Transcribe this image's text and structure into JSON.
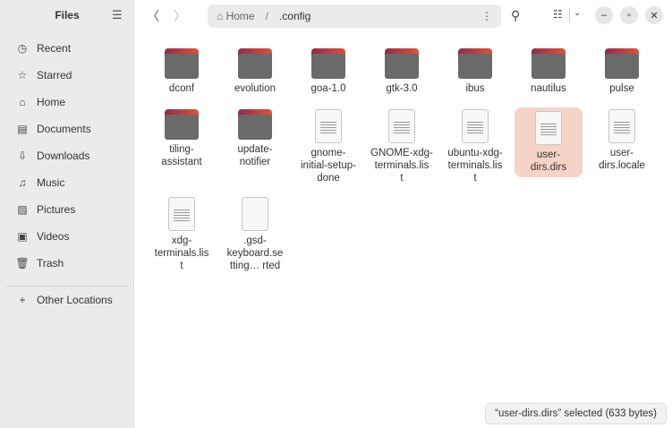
{
  "sidebar": {
    "title": "Files",
    "items": [
      {
        "label": "Recent",
        "icon": "clock"
      },
      {
        "label": "Starred",
        "icon": "star"
      },
      {
        "label": "Home",
        "icon": "home"
      },
      {
        "label": "Documents",
        "icon": "document"
      },
      {
        "label": "Downloads",
        "icon": "download"
      },
      {
        "label": "Music",
        "icon": "music"
      },
      {
        "label": "Pictures",
        "icon": "picture"
      },
      {
        "label": "Videos",
        "icon": "video"
      },
      {
        "label": "Trash",
        "icon": "trash"
      }
    ],
    "other": "Other Locations"
  },
  "path": {
    "home": "Home",
    "sep": "/",
    "current": ".config"
  },
  "files": [
    {
      "name": "dconf",
      "type": "folder"
    },
    {
      "name": "evolution",
      "type": "folder"
    },
    {
      "name": "goa-1.0",
      "type": "folder"
    },
    {
      "name": "gtk-3.0",
      "type": "folder"
    },
    {
      "name": "ibus",
      "type": "folder"
    },
    {
      "name": "nautilus",
      "type": "folder"
    },
    {
      "name": "pulse",
      "type": "folder"
    },
    {
      "name": "tiling-\nassistant",
      "type": "folder"
    },
    {
      "name": "update-\nnotifier",
      "type": "folder"
    },
    {
      "name": "gnome-\ninitial-setup-\ndone",
      "type": "text"
    },
    {
      "name": "GNOME-xdg-\nterminals.lis\nt",
      "type": "text"
    },
    {
      "name": "ubuntu-xdg-\nterminals.lis\nt",
      "type": "text"
    },
    {
      "name": "user-\ndirs.dirs",
      "type": "text",
      "selected": true
    },
    {
      "name": "user-\ndirs.locale",
      "type": "text"
    },
    {
      "name": "xdg-\nterminals.lis\nt",
      "type": "text"
    },
    {
      "name": ".gsd-\nkeyboard.se\ntting…  rted",
      "type": "blank"
    }
  ],
  "status": "“user-dirs.dirs” selected  (633 bytes)",
  "colors": {
    "selection": "#f6d3c7",
    "accent": "#e95420"
  }
}
